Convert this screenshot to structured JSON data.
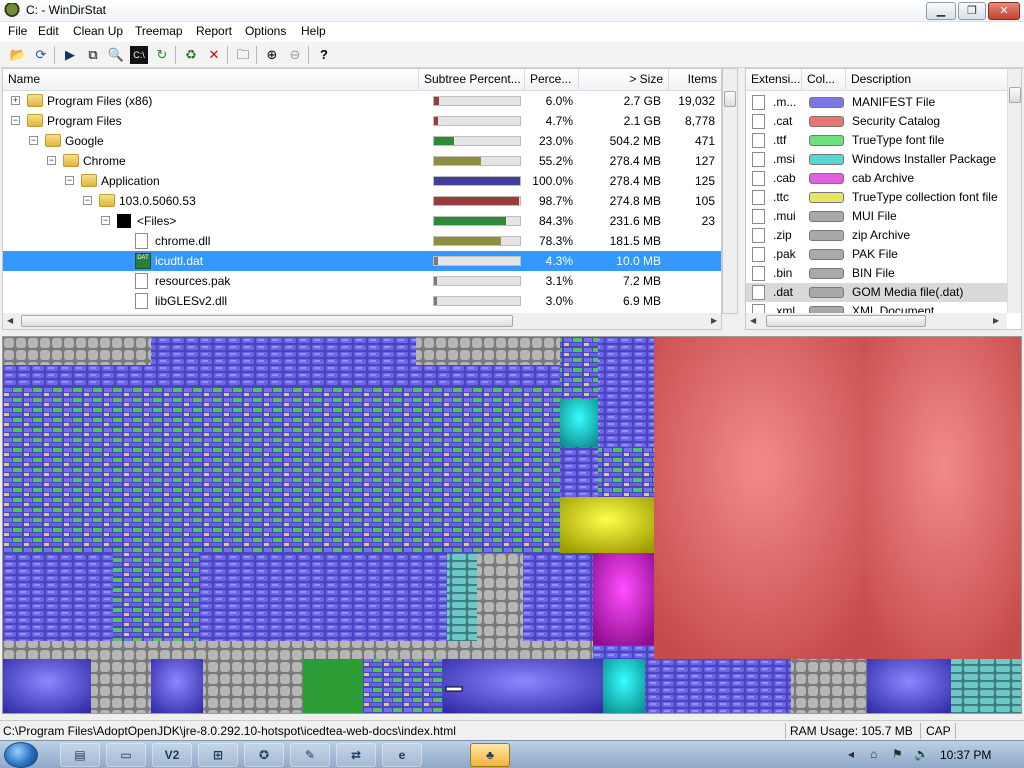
{
  "window": {
    "title": "C: - WinDirStat"
  },
  "menu": [
    "File",
    "Edit",
    "Clean Up",
    "Treemap",
    "Report",
    "Options",
    "Help"
  ],
  "toolbar_icons": [
    "open-icon",
    "refresh-icon",
    "play-icon",
    "copy-icon",
    "explorer-icon",
    "cmd-icon",
    "refresh-selected-icon",
    "recycle-icon",
    "delete-icon",
    "folder-icon",
    "zoom-in-icon",
    "zoom-out-icon",
    "help-icon"
  ],
  "dir_columns": [
    "Name",
    "Subtree Percent...",
    "Perce...",
    "> Size",
    "Items"
  ],
  "dir_rows": [
    {
      "name": "Program Files (x86)",
      "level": 0,
      "expander": "+",
      "icon": "folder",
      "bar": 0.06,
      "bar_color": "#9b3b3b",
      "pct": "6.0%",
      "size": "2.7 GB",
      "items": "19,032"
    },
    {
      "name": "Program Files",
      "level": 0,
      "expander": "−",
      "icon": "folder",
      "bar": 0.047,
      "bar_color": "#9b3b3b",
      "pct": "4.7%",
      "size": "2.1 GB",
      "items": "8,778"
    },
    {
      "name": "Google",
      "level": 1,
      "expander": "−",
      "icon": "folder",
      "bar": 0.23,
      "bar_color": "#2f8a3a",
      "pct": "23.0%",
      "size": "504.2 MB",
      "items": "471"
    },
    {
      "name": "Chrome",
      "level": 2,
      "expander": "−",
      "icon": "folder",
      "bar": 0.552,
      "bar_color": "#8f8f3d",
      "pct": "55.2%",
      "size": "278.4 MB",
      "items": "127"
    },
    {
      "name": "Application",
      "level": 3,
      "expander": "−",
      "icon": "folder",
      "bar": 1.0,
      "bar_color": "#3f3f99",
      "pct": "100.0%",
      "size": "278.4 MB",
      "items": "125"
    },
    {
      "name": "103.0.5060.53",
      "level": 4,
      "expander": "−",
      "icon": "folder",
      "bar": 0.987,
      "bar_color": "#993b3b",
      "pct": "98.7%",
      "size": "274.8 MB",
      "items": "105"
    },
    {
      "name": "<Files>",
      "level": 5,
      "expander": "−",
      "icon": "black",
      "bar": 0.843,
      "bar_color": "#2f8a3a",
      "pct": "84.3%",
      "size": "231.6 MB",
      "items": "23"
    },
    {
      "name": "chrome.dll",
      "level": 6,
      "expander": "",
      "icon": "file",
      "bar": 0.783,
      "bar_color": "#8f8f3d",
      "pct": "78.3%",
      "size": "181.5 MB",
      "items": ""
    },
    {
      "name": "icudtl.dat",
      "level": 6,
      "expander": "",
      "icon": "dat",
      "bar": 0.043,
      "bar_color": "#7a7a7a",
      "pct": "4.3%",
      "size": "10.0 MB",
      "items": "",
      "selected": true
    },
    {
      "name": "resources.pak",
      "level": 6,
      "expander": "",
      "icon": "file",
      "bar": 0.031,
      "bar_color": "#7a7a7a",
      "pct": "3.1%",
      "size": "7.2 MB",
      "items": ""
    },
    {
      "name": "libGLESv2.dll",
      "level": 6,
      "expander": "",
      "icon": "file",
      "bar": 0.03,
      "bar_color": "#7a7a7a",
      "pct": "3.0%",
      "size": "6.9 MB",
      "items": ""
    }
  ],
  "ext_columns": [
    "Extensi...",
    "Col...",
    "Description"
  ],
  "ext_rows": [
    {
      "ext": ".m...",
      "color": "#7b78e6",
      "desc": "MANIFEST File"
    },
    {
      "ext": ".cat",
      "color": "#ec7474",
      "desc": "Security Catalog"
    },
    {
      "ext": ".ttf",
      "color": "#6fe07b",
      "desc": "TrueType font file"
    },
    {
      "ext": ".msi",
      "color": "#57d6d4",
      "desc": "Windows Installer Package"
    },
    {
      "ext": ".cab",
      "color": "#e25fe0",
      "desc": "cab Archive"
    },
    {
      "ext": ".ttc",
      "color": "#e5e56a",
      "desc": "TrueType collection font file"
    },
    {
      "ext": ".mui",
      "color": "#a9a9a9",
      "desc": "MUI File"
    },
    {
      "ext": ".zip",
      "color": "#a9a9a9",
      "desc": "zip Archive"
    },
    {
      "ext": ".pak",
      "color": "#a9a9a9",
      "desc": "PAK File"
    },
    {
      "ext": ".bin",
      "color": "#a9a9a9",
      "desc": "BIN File"
    },
    {
      "ext": ".dat",
      "color": "#a9a9a9",
      "desc": "GOM Media file(.dat)",
      "selected": true
    },
    {
      "ext": ".xml",
      "color": "#a9a9a9",
      "desc": "XML Document"
    }
  ],
  "status": {
    "path": "C:\\Program Files\\AdoptOpenJDK\\jre-8.0.292.10-hotspot\\icedtea-web-docs\\index.html",
    "ram": "RAM Usage:   105.7 MB",
    "cap": "CAP"
  },
  "taskbar": {
    "buttons": [
      {
        "name": "taskbar-explorer-button",
        "label": "▤"
      },
      {
        "name": "taskbar-folder-button",
        "label": "▭"
      },
      {
        "name": "taskbar-virtualbox-button",
        "label": "V2"
      },
      {
        "name": "taskbar-windows-button",
        "label": "⊞"
      },
      {
        "name": "taskbar-firefox-button",
        "label": "✪"
      },
      {
        "name": "taskbar-pen-button",
        "label": "✎"
      },
      {
        "name": "taskbar-network-button",
        "label": "⇄"
      },
      {
        "name": "taskbar-edge-button",
        "label": "e"
      },
      {
        "name": "taskbar-windirstat-button",
        "label": "♣",
        "active": true
      }
    ],
    "tray": [
      "◂",
      "⌂",
      "⚑",
      "🔊"
    ],
    "clock": "10:37 PM"
  }
}
